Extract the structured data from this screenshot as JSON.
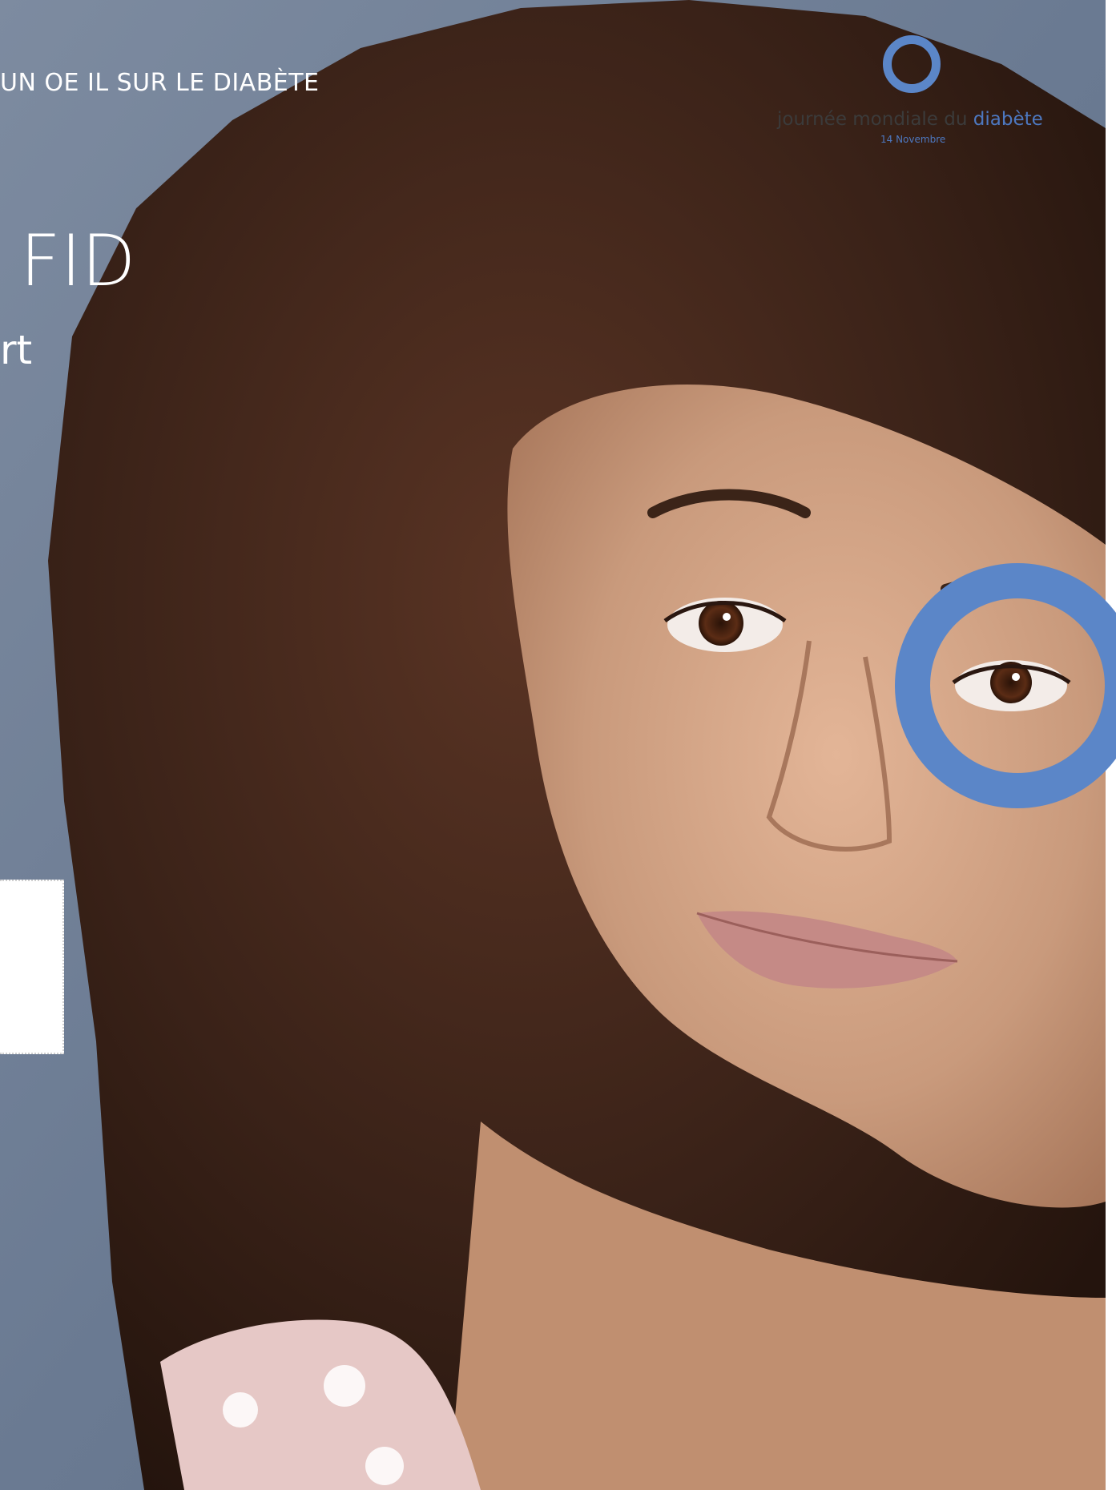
{
  "colors": {
    "brand_blue": "#5b86c8",
    "logo_text": "#3b3b3b",
    "wall_gray_blue": "#6f7f96",
    "hair_brown": "#3a2418",
    "skin_tone": "#c99a7c"
  },
  "headline": {
    "campaign_line": "UN OE IL SUR LE DIABÈTE",
    "title_fragment": "FID",
    "subtitle_fragment": "rt"
  },
  "logo": {
    "icon": "blue-circle-icon",
    "text_main": "journée mondiale du",
    "text_accent": "diabète",
    "date": "14 Novembre"
  },
  "graphic": {
    "eye_circle_icon": "blue-circle-icon"
  }
}
